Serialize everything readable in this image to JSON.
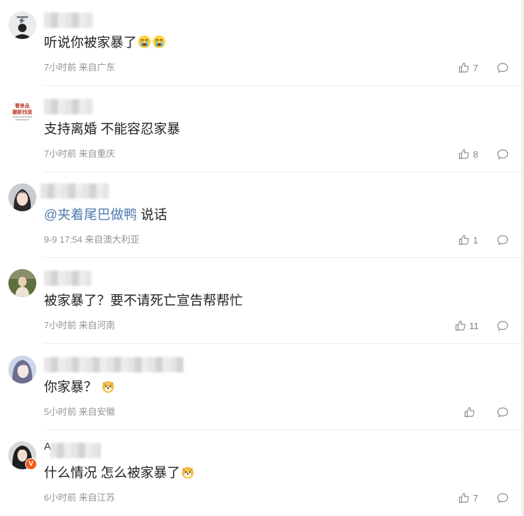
{
  "comments": [
    {
      "username_visible": "",
      "text": "听说你被家暴了",
      "emojis": [
        "crying-face",
        "crying-face"
      ],
      "time": "7小时前",
      "location": "来自广东",
      "likes": "7"
    },
    {
      "username_visible": "",
      "avatar_logo_text": "奢侈品 翻新找我",
      "text": "支持离婚 不能容忍家暴",
      "emojis": [],
      "time": "7小时前",
      "location": "来自重庆",
      "likes": "8"
    },
    {
      "username_visible": "",
      "mention": "@夹着尾巴做鸭",
      "text": "说话",
      "emojis": [],
      "time": "9-9 17:54",
      "location": "来自澳大利亚",
      "likes": "1"
    },
    {
      "username_visible": "",
      "text": "被家暴了？要不请死亡宣告帮帮忙",
      "emojis": [],
      "time": "7小时前",
      "location": "来自河南",
      "likes": "11"
    },
    {
      "username_visible": "",
      "text": "你家暴？",
      "emojis": [
        "doge"
      ],
      "time": "5小时前",
      "location": "来自安徽",
      "likes": ""
    },
    {
      "username_visible": "A",
      "text": "什么情况 怎么被家暴了",
      "emojis": [
        "doge"
      ],
      "time": "6小时前",
      "location": "来自江苏",
      "likes": "7",
      "verified_badge": "V"
    }
  ],
  "icons": {
    "like": "thumbs-up-icon",
    "reply": "comment-bubble-icon"
  },
  "colors": {
    "mention": "#4f7cae",
    "meta": "#939393",
    "divider": "#eeeeee",
    "verified": "#f35a1a"
  }
}
